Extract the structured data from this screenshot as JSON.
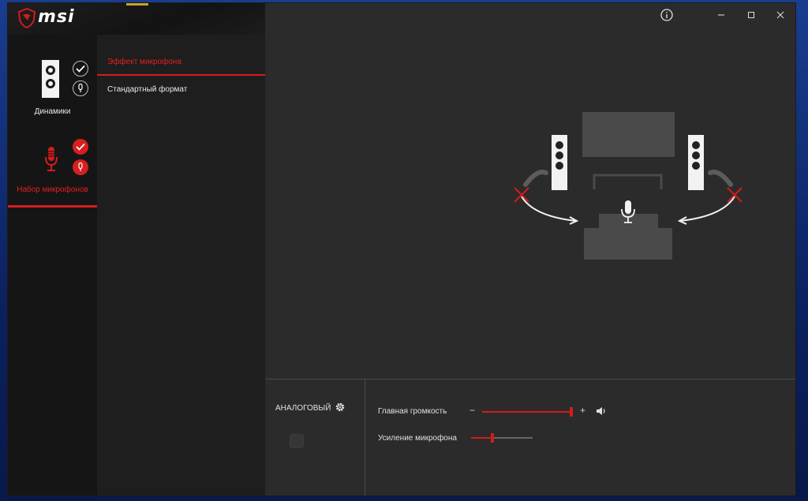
{
  "app": {
    "brand": "msi",
    "accent_color": "#d41c1c"
  },
  "title_buttons": [
    {
      "name": "info-icon"
    },
    {
      "name": "minimize-icon"
    },
    {
      "name": "maximize-icon"
    },
    {
      "name": "close-icon"
    }
  ],
  "sidebar": {
    "devices": [
      {
        "label": "Динамики",
        "icon": "speaker-icon",
        "active": false
      },
      {
        "label": "Набор микрофонов",
        "icon": "microphone-icon",
        "active": true
      }
    ]
  },
  "tabs": [
    {
      "label": "Эффект микрофона",
      "active": true
    },
    {
      "label": "Стандартный формат",
      "active": false
    }
  ],
  "bottom": {
    "analog_label": "АНАЛОГОВЫЙ",
    "master_volume_label": "Главная громкость",
    "master_volume_minus": "−",
    "master_volume_plus": "+",
    "master_volume_level": 1.0,
    "mic_boost_label": "Усиление микрофона",
    "mic_boost_level": 0.35
  }
}
